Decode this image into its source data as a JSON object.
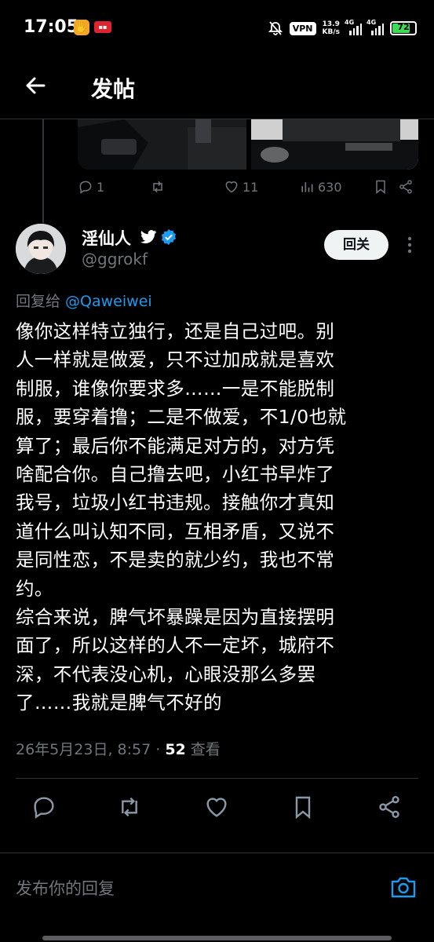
{
  "status_bar": {
    "time": "17:05",
    "vpn": "VPN",
    "speed_value": "13.9",
    "speed_unit": "KB/s",
    "net1": "4G",
    "net2": "4G",
    "battery": "72"
  },
  "header": {
    "title": "发帖",
    "back_icon": "arrow-left-icon"
  },
  "previous_tweet": {
    "replies": "1",
    "likes": "11",
    "views": "630"
  },
  "tweet": {
    "author_name": "淫仙人",
    "author_handle": "@ggrokf",
    "follow_label": "回关",
    "reply_prefix": "回复给 ",
    "reply_to": "@Qaweiwei",
    "body_lines": [
      "像你这样特立独行，还是自己过吧。别",
      "人一样就是做爱，只不过加成就是喜欢",
      "制服，谁像你要求多……一是不能脱制",
      "服，要穿着撸；二是不做爱，不1/0也就",
      "算了；最后你不能满足对方的，对方凭",
      "啥配合你。自己撸去吧，小红书早炸了",
      "我号，垃圾小红书违规。接触你才真知",
      "道什么叫认知不同，互相矛盾，又说不",
      "是同性恋，不是卖的就少约，我也不常",
      "约。",
      "综合来说，脾气坏暴躁是因为直接摆明",
      "面了，所以这样的人不一定坏，城府不",
      "深，不代表没心机，心眼没那么多罢",
      "了……我就是脾气不好的"
    ],
    "date": "26年5月23日, 8:57 · ",
    "views_count": "52",
    "views_label": " 查看"
  },
  "reply_box": {
    "placeholder": "发布你的回复"
  },
  "colors": {
    "background": "#000000",
    "accent": "#1d9bf0",
    "muted": "#71767b",
    "battery": "#3ddc54"
  }
}
